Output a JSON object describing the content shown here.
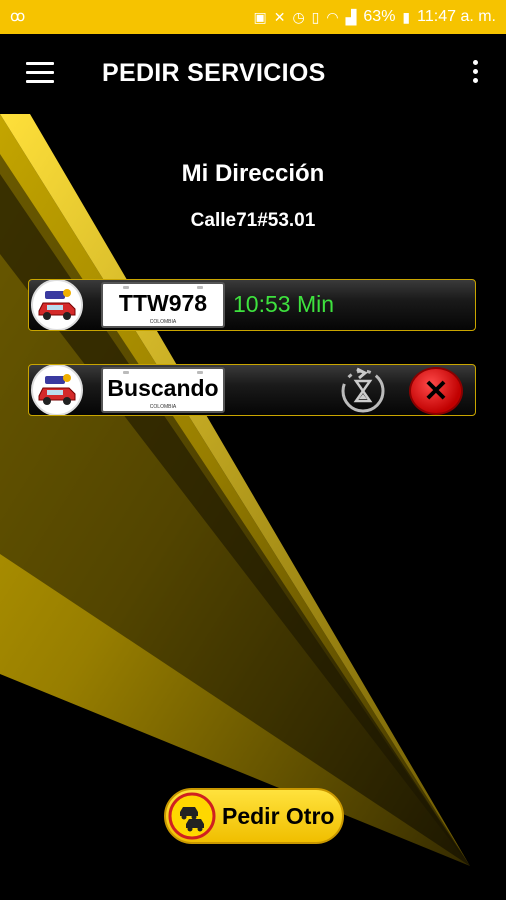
{
  "status_bar": {
    "battery": "63%",
    "time": "11:47 a. m."
  },
  "app_bar": {
    "title": "PEDIR SERVICIOS",
    "menu_icon": "hamburger-menu-icon",
    "more_icon": "more-vert-icon"
  },
  "address": {
    "label": "Mi Dirección",
    "value": "Calle71#53.01"
  },
  "services": [
    {
      "plate": "TTW978",
      "plate_country": "COLOMBIA",
      "eta": "10:53 Min",
      "status_color": "#3ee23e"
    },
    {
      "plate": "Buscando",
      "plate_country": "COLOMBIA"
    }
  ],
  "actions": {
    "request_another": "Pedir Otro"
  },
  "colors": {
    "accent": "#f6c300",
    "eta_green": "#3ee23e",
    "cancel_red": "#e01515"
  }
}
